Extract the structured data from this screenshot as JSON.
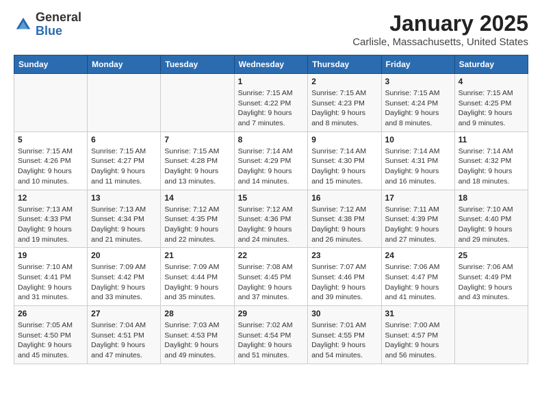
{
  "header": {
    "logo": {
      "general": "General",
      "blue": "Blue"
    },
    "title": "January 2025",
    "location": "Carlisle, Massachusetts, United States"
  },
  "days_of_week": [
    "Sunday",
    "Monday",
    "Tuesday",
    "Wednesday",
    "Thursday",
    "Friday",
    "Saturday"
  ],
  "weeks": [
    [
      {
        "day": "",
        "sunrise": "",
        "sunset": "",
        "daylight": ""
      },
      {
        "day": "",
        "sunrise": "",
        "sunset": "",
        "daylight": ""
      },
      {
        "day": "",
        "sunrise": "",
        "sunset": "",
        "daylight": ""
      },
      {
        "day": "1",
        "sunrise": "Sunrise: 7:15 AM",
        "sunset": "Sunset: 4:22 PM",
        "daylight": "Daylight: 9 hours and 7 minutes."
      },
      {
        "day": "2",
        "sunrise": "Sunrise: 7:15 AM",
        "sunset": "Sunset: 4:23 PM",
        "daylight": "Daylight: 9 hours and 8 minutes."
      },
      {
        "day": "3",
        "sunrise": "Sunrise: 7:15 AM",
        "sunset": "Sunset: 4:24 PM",
        "daylight": "Daylight: 9 hours and 8 minutes."
      },
      {
        "day": "4",
        "sunrise": "Sunrise: 7:15 AM",
        "sunset": "Sunset: 4:25 PM",
        "daylight": "Daylight: 9 hours and 9 minutes."
      }
    ],
    [
      {
        "day": "5",
        "sunrise": "Sunrise: 7:15 AM",
        "sunset": "Sunset: 4:26 PM",
        "daylight": "Daylight: 9 hours and 10 minutes."
      },
      {
        "day": "6",
        "sunrise": "Sunrise: 7:15 AM",
        "sunset": "Sunset: 4:27 PM",
        "daylight": "Daylight: 9 hours and 11 minutes."
      },
      {
        "day": "7",
        "sunrise": "Sunrise: 7:15 AM",
        "sunset": "Sunset: 4:28 PM",
        "daylight": "Daylight: 9 hours and 13 minutes."
      },
      {
        "day": "8",
        "sunrise": "Sunrise: 7:14 AM",
        "sunset": "Sunset: 4:29 PM",
        "daylight": "Daylight: 9 hours and 14 minutes."
      },
      {
        "day": "9",
        "sunrise": "Sunrise: 7:14 AM",
        "sunset": "Sunset: 4:30 PM",
        "daylight": "Daylight: 9 hours and 15 minutes."
      },
      {
        "day": "10",
        "sunrise": "Sunrise: 7:14 AM",
        "sunset": "Sunset: 4:31 PM",
        "daylight": "Daylight: 9 hours and 16 minutes."
      },
      {
        "day": "11",
        "sunrise": "Sunrise: 7:14 AM",
        "sunset": "Sunset: 4:32 PM",
        "daylight": "Daylight: 9 hours and 18 minutes."
      }
    ],
    [
      {
        "day": "12",
        "sunrise": "Sunrise: 7:13 AM",
        "sunset": "Sunset: 4:33 PM",
        "daylight": "Daylight: 9 hours and 19 minutes."
      },
      {
        "day": "13",
        "sunrise": "Sunrise: 7:13 AM",
        "sunset": "Sunset: 4:34 PM",
        "daylight": "Daylight: 9 hours and 21 minutes."
      },
      {
        "day": "14",
        "sunrise": "Sunrise: 7:12 AM",
        "sunset": "Sunset: 4:35 PM",
        "daylight": "Daylight: 9 hours and 22 minutes."
      },
      {
        "day": "15",
        "sunrise": "Sunrise: 7:12 AM",
        "sunset": "Sunset: 4:36 PM",
        "daylight": "Daylight: 9 hours and 24 minutes."
      },
      {
        "day": "16",
        "sunrise": "Sunrise: 7:12 AM",
        "sunset": "Sunset: 4:38 PM",
        "daylight": "Daylight: 9 hours and 26 minutes."
      },
      {
        "day": "17",
        "sunrise": "Sunrise: 7:11 AM",
        "sunset": "Sunset: 4:39 PM",
        "daylight": "Daylight: 9 hours and 27 minutes."
      },
      {
        "day": "18",
        "sunrise": "Sunrise: 7:10 AM",
        "sunset": "Sunset: 4:40 PM",
        "daylight": "Daylight: 9 hours and 29 minutes."
      }
    ],
    [
      {
        "day": "19",
        "sunrise": "Sunrise: 7:10 AM",
        "sunset": "Sunset: 4:41 PM",
        "daylight": "Daylight: 9 hours and 31 minutes."
      },
      {
        "day": "20",
        "sunrise": "Sunrise: 7:09 AM",
        "sunset": "Sunset: 4:42 PM",
        "daylight": "Daylight: 9 hours and 33 minutes."
      },
      {
        "day": "21",
        "sunrise": "Sunrise: 7:09 AM",
        "sunset": "Sunset: 4:44 PM",
        "daylight": "Daylight: 9 hours and 35 minutes."
      },
      {
        "day": "22",
        "sunrise": "Sunrise: 7:08 AM",
        "sunset": "Sunset: 4:45 PM",
        "daylight": "Daylight: 9 hours and 37 minutes."
      },
      {
        "day": "23",
        "sunrise": "Sunrise: 7:07 AM",
        "sunset": "Sunset: 4:46 PM",
        "daylight": "Daylight: 9 hours and 39 minutes."
      },
      {
        "day": "24",
        "sunrise": "Sunrise: 7:06 AM",
        "sunset": "Sunset: 4:47 PM",
        "daylight": "Daylight: 9 hours and 41 minutes."
      },
      {
        "day": "25",
        "sunrise": "Sunrise: 7:06 AM",
        "sunset": "Sunset: 4:49 PM",
        "daylight": "Daylight: 9 hours and 43 minutes."
      }
    ],
    [
      {
        "day": "26",
        "sunrise": "Sunrise: 7:05 AM",
        "sunset": "Sunset: 4:50 PM",
        "daylight": "Daylight: 9 hours and 45 minutes."
      },
      {
        "day": "27",
        "sunrise": "Sunrise: 7:04 AM",
        "sunset": "Sunset: 4:51 PM",
        "daylight": "Daylight: 9 hours and 47 minutes."
      },
      {
        "day": "28",
        "sunrise": "Sunrise: 7:03 AM",
        "sunset": "Sunset: 4:53 PM",
        "daylight": "Daylight: 9 hours and 49 minutes."
      },
      {
        "day": "29",
        "sunrise": "Sunrise: 7:02 AM",
        "sunset": "Sunset: 4:54 PM",
        "daylight": "Daylight: 9 hours and 51 minutes."
      },
      {
        "day": "30",
        "sunrise": "Sunrise: 7:01 AM",
        "sunset": "Sunset: 4:55 PM",
        "daylight": "Daylight: 9 hours and 54 minutes."
      },
      {
        "day": "31",
        "sunrise": "Sunrise: 7:00 AM",
        "sunset": "Sunset: 4:57 PM",
        "daylight": "Daylight: 9 hours and 56 minutes."
      },
      {
        "day": "",
        "sunrise": "",
        "sunset": "",
        "daylight": ""
      }
    ]
  ]
}
